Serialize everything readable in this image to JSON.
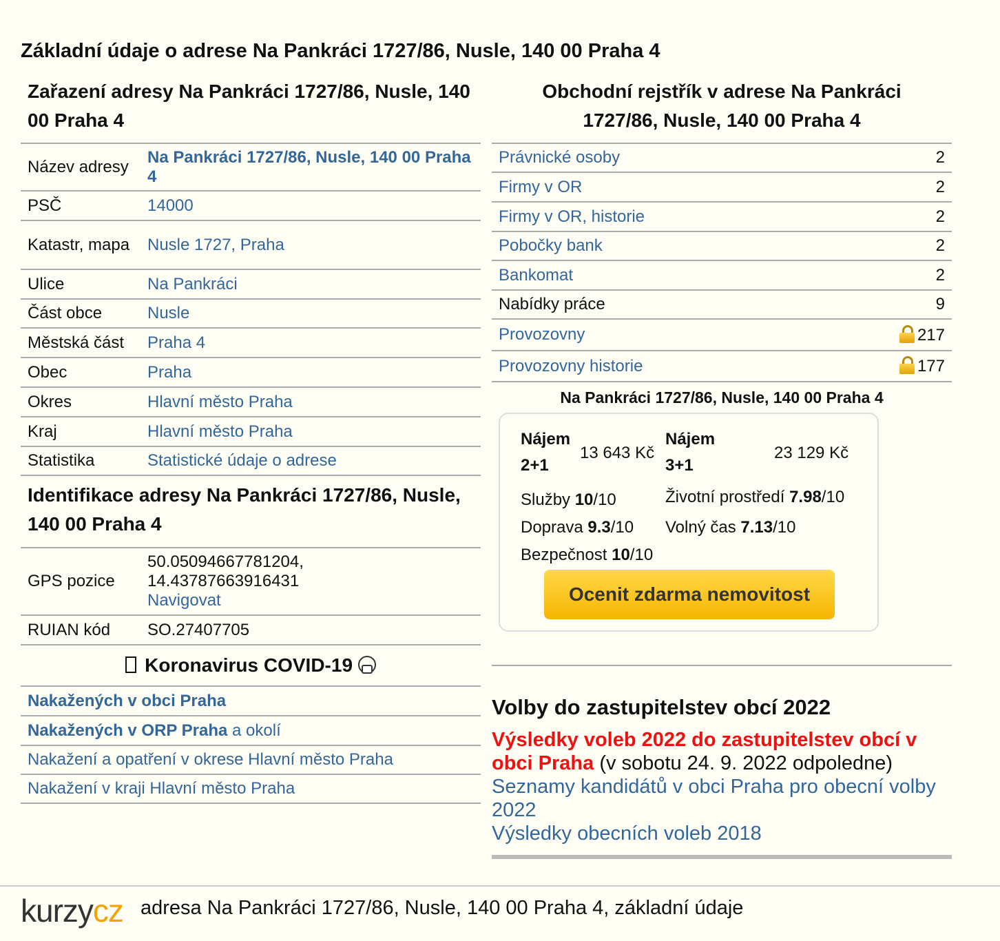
{
  "page_title": "Základní údaje o adrese Na Pankráci 1727/86, Nusle, 140 00 Praha 4",
  "zarazeni": {
    "title": "Zařazení adresy Na Pankráci 1727/86, Nusle, 140 00 Praha 4",
    "rows": [
      {
        "label": "Název adresy",
        "value": "Na Pankráci 1727/86, Nusle, 140 00 Praha 4"
      },
      {
        "label": "PSČ",
        "value": "14000"
      },
      {
        "label": "Katastr, mapa",
        "value": "Nusle 1727, Praha"
      },
      {
        "label": "Ulice",
        "value": "Na Pankráci"
      },
      {
        "label": "Část obce",
        "value": "Nusle"
      },
      {
        "label": "Městská část",
        "value": "Praha 4"
      },
      {
        "label": "Obec",
        "value": "Praha"
      },
      {
        "label": "Okres",
        "value": "Hlavní město Praha"
      },
      {
        "label": "Kraj",
        "value": "Hlavní město Praha"
      },
      {
        "label": "Statistika",
        "value": "Statistické údaje o adrese"
      }
    ]
  },
  "identifikace": {
    "title": "Identifikace adresy Na Pankráci 1727/86, Nusle, 140 00 Praha 4",
    "gps_label": "GPS pozice",
    "gps_lat": "50.05094667781204,",
    "gps_lon": "14.43787663916431",
    "navigate": "Navigovat",
    "ruian_label": "RUIAN kód",
    "ruian_value": "SO.27407705"
  },
  "covid": {
    "title": "Koronavirus COVID-19",
    "links": [
      {
        "text": "Nakažených v obci Praha"
      },
      {
        "text": "Nakažených v ORP Praha",
        "suffix": " a okolí"
      },
      {
        "text": "Nakažení a opatření v okrese Hlavní město Praha"
      },
      {
        "text": "Nakažení v kraji Hlavní město Praha"
      }
    ]
  },
  "rejstrik": {
    "title": "Obchodní rejstřík v adrese Na Pankráci 1727/86, Nusle, 140 00 Praha 4",
    "rows": [
      {
        "label": "Právnické osoby",
        "count": "2"
      },
      {
        "label": "Firmy v OR",
        "count": "2"
      },
      {
        "label": "Firmy v OR, historie",
        "count": "2"
      },
      {
        "label": "Pobočky bank",
        "count": "2"
      },
      {
        "label": "Bankomat",
        "count": "2"
      },
      {
        "label": "Nabídky práce",
        "count": "9"
      },
      {
        "label": "Provozovny",
        "count": "217"
      },
      {
        "label": "Provozovny historie",
        "count": "177"
      }
    ]
  },
  "property": {
    "address": "Na Pankráci 1727/86, Nusle, 140 00 Praha 4",
    "rent1_label_a": "Nájem",
    "rent1_label_b": "2+1",
    "rent1_value": "13 643 Kč",
    "rent2_label_a": "Nájem",
    "rent2_label_b": "3+1",
    "rent2_value": "23 129 Kč",
    "sluzby_label": "Služby ",
    "sluzby_value": "10",
    "sluzby_max": "/10",
    "zivotni_label": "Životní prostředí ",
    "zivotni_value": "7.98",
    "zivotni_max": "/10",
    "doprava_label": "Doprava ",
    "doprava_value": "9.3",
    "doprava_max": "/10",
    "volny_label": "Volný čas ",
    "volny_value": "7.13",
    "volny_max": "/10",
    "bezpecnost_label": "Bezpečnost ",
    "bezpecnost_value": "10",
    "bezpecnost_max": "/10",
    "cta": "Ocenit zdarma nemovitost"
  },
  "volby": {
    "title": "Volby do zastupitelstev obcí 2022",
    "result_link": "Výsledky voleb 2022 do zastupitelstev obcí v obci Praha",
    "result_note": " (v sobotu 24. 9. 2022 odpoledne)",
    "candidates_link": "Seznamy kandidátů v obci Praha pro obecní volby 2022",
    "results2018_link": "Výsledky obecních voleb 2018"
  },
  "footer": {
    "logo_a": "kurzy",
    "logo_b": "cz",
    "text": "adresa Na Pankráci 1727/86, Nusle, 140 00 Praha 4, základní údaje"
  }
}
